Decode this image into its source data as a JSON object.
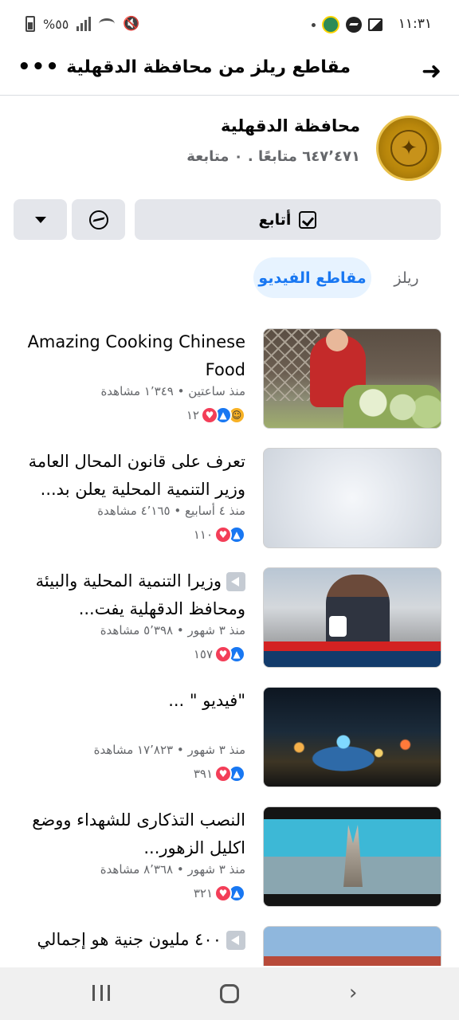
{
  "status_bar": {
    "time": "١١:٣١",
    "battery": "%٥٥"
  },
  "header": {
    "title": "مقاطع ريلز من محافظة الدقهلية",
    "back_icon": "arrow-icon",
    "more_icon": "more-dots-icon"
  },
  "profile": {
    "name": "محافظة الدقهلية",
    "stats": "٦٤٧٬٤٧١ متابعًا . ٠ متابعة"
  },
  "actions": {
    "follow_label": "أتابع"
  },
  "tabs": {
    "videos": "مقاطع الفيديو",
    "reels": "ريلز"
  },
  "videos": [
    {
      "title": "Amazing Cooking Chinese Food",
      "meta": "منذ ساعتين • ١٬٣٤٩ مشاهدة",
      "reactions_count": "١٢",
      "reactions": [
        "haha",
        "like",
        "love"
      ]
    },
    {
      "title": "تعرف على قانون المحال العامة وزير التنمية المحلية يعلن بد...",
      "meta": "منذ ٤ أسابيع • ٤٬١٦٥ مشاهدة",
      "reactions_count": "١١٠",
      "reactions": [
        "like",
        "love"
      ]
    },
    {
      "title": "وزيرا التنمية المحلية والبيئة ومحافظ الدقهلية يفت...",
      "meta": "منذ ٣ شهور • ٥٬٣٩٨ مشاهدة",
      "reactions_count": "١٥٧",
      "reactions": [
        "like",
        "love"
      ]
    },
    {
      "title": "\"فيديو \" ...",
      "meta": "منذ ٣ شهور • ١٧٬٨٢٣ مشاهدة",
      "reactions_count": "٣٩١",
      "reactions": [
        "like",
        "love"
      ]
    },
    {
      "title": "النصب التذكارى للشهداء ووضع اكليل الزهور...",
      "meta": "منذ ٣ شهور • ٨٬٣٦٨ مشاهدة",
      "reactions_count": "٣٢١",
      "reactions": [
        "like",
        "love"
      ]
    },
    {
      "title": "٤٠٠ مليون جنية هو إجمالي",
      "meta": "",
      "reactions_count": "",
      "reactions": []
    }
  ],
  "colors": {
    "accent": "#1877f2",
    "tab_active_bg": "#e7f3ff",
    "button_bg": "#e4e6eb",
    "secondary_text": "#65676b"
  }
}
